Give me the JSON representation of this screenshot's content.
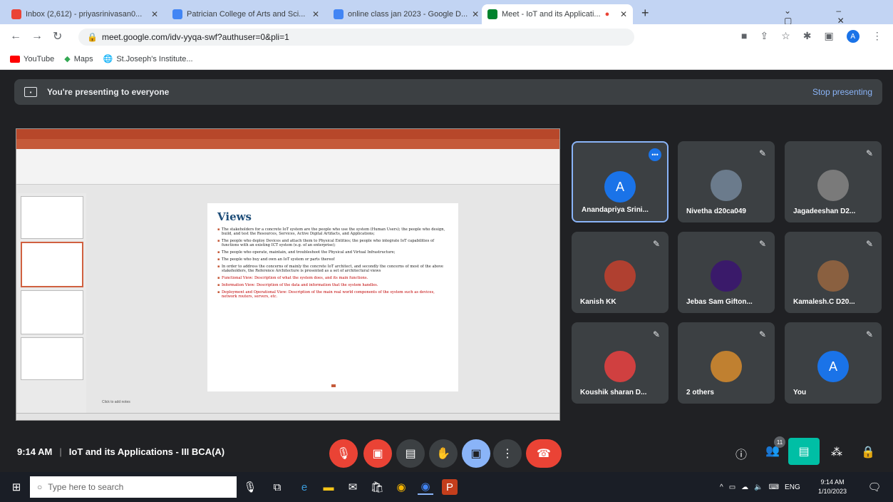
{
  "tabs": [
    {
      "label": "Inbox (2,612) - priyasrinivasan0...",
      "color": "#ea4335"
    },
    {
      "label": "Patrician College of Arts and Sci...",
      "color": "#4285f4"
    },
    {
      "label": "online class jan 2023 - Google D...",
      "color": "#4285f4"
    },
    {
      "label": "Meet - IoT and its Applicati...",
      "color": "#00832d"
    }
  ],
  "url": "meet.google.com/idv-yyqa-swf?authuser=0&pli=1",
  "bookmarks": [
    "YouTube",
    "Maps",
    "St.Joseph's Institute..."
  ],
  "banner": {
    "text": "You're presenting to everyone",
    "stop": "Stop presenting"
  },
  "slide": {
    "title": "Views",
    "bullets": [
      "The stakeholders for a concrete IoT system are the people who use the system (Human Users); the people who design, build, and test the Resources, Services, Active Digital Artifacts, and Applications;",
      "The people who deploy Devices and attach them to Physical Entities; the people who integrate IoT capabilities of functions with an existing ICT system (e.g. of an enterprise);",
      "The people who operate, maintain, and troubleshoot the Physical and Virtual Infrastructure;",
      "The people who buy and own an IoT system or parts thereof",
      "In order to address the concerns of mainly the concrete IoT architect, and secondly the concerns of most of the above stakeholders, the Reference Architecture is presented as a set of architectural views",
      "Functional View: Description of what the system does, and its main functions.",
      "Information View: Description of the data and information that the system handles.",
      "Deployment and Operational View: Description of the main real world components of the system such as devices, network routers, servers, etc."
    ],
    "notes": "Click to add notes"
  },
  "participants": [
    {
      "name": "Anandapriya Srini...",
      "initial": "A",
      "color": "#1a73e8"
    },
    {
      "name": "Nivetha d20ca049",
      "initial": "",
      "color": "#6b7b8c"
    },
    {
      "name": "Jagadeeshan D2...",
      "initial": "",
      "color": "#7a7a7a"
    },
    {
      "name": "Kanish KK",
      "initial": "",
      "color": "#b04030"
    },
    {
      "name": "Jebas Sam Gifton...",
      "initial": "",
      "color": "#3a1a6a"
    },
    {
      "name": "Kamalesh.C D20...",
      "initial": "",
      "color": "#8a6040"
    },
    {
      "name": "Koushik sharan D...",
      "initial": "",
      "color": "#d04040"
    },
    {
      "name": "2 others",
      "initial": "",
      "color": "#c08030"
    },
    {
      "name": "You",
      "initial": "A",
      "color": "#1a73e8"
    }
  ],
  "meeting": {
    "time": "9:14 AM",
    "title": "IoT and its Applications - III BCA(A)",
    "badge": "11"
  },
  "taskbar": {
    "search": "Type here to search",
    "time": "9:14 AM",
    "date": "1/10/2023",
    "lang": "ENG"
  }
}
